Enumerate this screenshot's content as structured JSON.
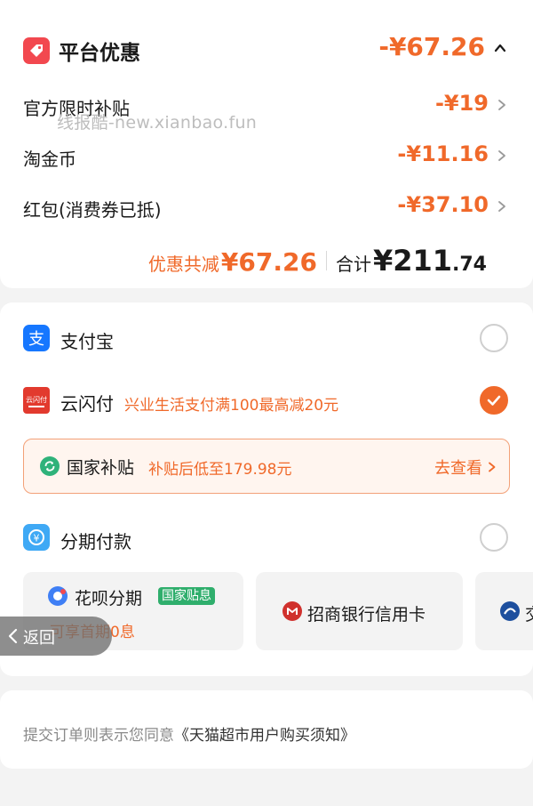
{
  "discounts": {
    "header_title": "平台优惠",
    "header_amount": "-¥67.26",
    "watermark": "线报酷-new.xianbao.fun",
    "items": [
      {
        "label": "官方限时补贴",
        "amount": "-¥19"
      },
      {
        "label": "淘金币",
        "amount": "-¥11.16"
      },
      {
        "label": "红包(消费券已抵)",
        "amount": "-¥37.10"
      }
    ],
    "summary": {
      "saved_label": "优惠共减",
      "saved_value": "¥67.26",
      "total_label": "合计",
      "total_int": "¥211",
      "total_dec": ".74"
    }
  },
  "payment": {
    "alipay": {
      "label": "支付宝",
      "icon": "alipay-icon",
      "selected": false
    },
    "unionpay": {
      "label": "云闪付",
      "icon": "quickpass-icon",
      "icon_text": "云闪付",
      "promo": "兴业生活支付满100最高减20元",
      "selected": true
    },
    "subsidy": {
      "title": "国家补贴",
      "desc": "补贴后低至179.98元",
      "link": "去查看"
    },
    "installment": {
      "label": "分期付款",
      "icon": "installment-icon",
      "selected": false
    },
    "plans": [
      {
        "title": "花呗分期",
        "badge": "国家贴息",
        "sub": "可享首期0息",
        "icon": "huabei-icon"
      },
      {
        "title": "招商银行信用卡",
        "icon": "cmb-icon"
      },
      {
        "title": "交",
        "icon": "bocom-icon"
      }
    ]
  },
  "back_button": {
    "label": "返回"
  },
  "terms": {
    "prefix": "提交订单则表示您同意",
    "link": "《天猫超市用户购买须知》"
  },
  "colors": {
    "accent": "#f0692a",
    "tag_red": "#f2484f",
    "alipay_blue": "#1677ff",
    "subsidy_green": "#2fb27a"
  }
}
